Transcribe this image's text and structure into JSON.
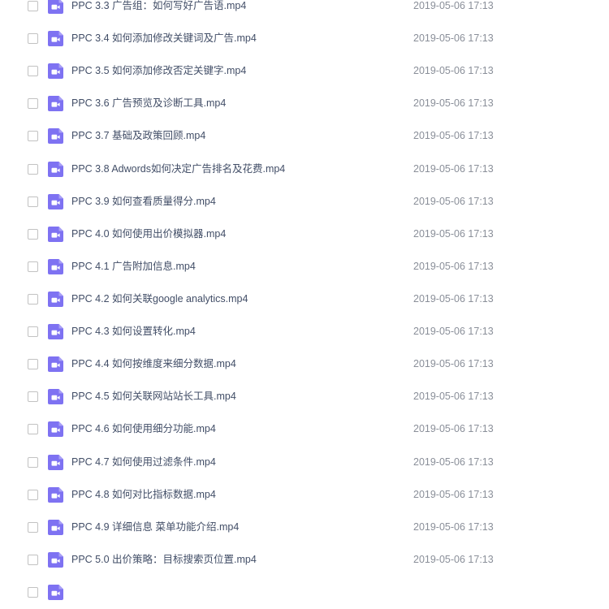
{
  "file_list": {
    "items": [
      {
        "name": "PPC 3.3 广告组：如何写好广告语.mp4",
        "date": "2019-05-06 17:13",
        "icon": "video-file-icon"
      },
      {
        "name": "PPC 3.4 如何添加修改关键词及广告.mp4",
        "date": "2019-05-06 17:13",
        "icon": "video-file-icon"
      },
      {
        "name": "PPC 3.5 如何添加修改否定关键字.mp4",
        "date": "2019-05-06 17:13",
        "icon": "video-file-icon"
      },
      {
        "name": "PPC 3.6 广告预览及诊断工具.mp4",
        "date": "2019-05-06 17:13",
        "icon": "video-file-icon"
      },
      {
        "name": "PPC 3.7 基础及政策回顾.mp4",
        "date": "2019-05-06 17:13",
        "icon": "video-file-icon"
      },
      {
        "name": "PPC 3.8 Adwords如何决定广告排名及花费.mp4",
        "date": "2019-05-06 17:13",
        "icon": "video-file-icon"
      },
      {
        "name": "PPC 3.9 如何查看质量得分.mp4",
        "date": "2019-05-06 17:13",
        "icon": "video-file-icon"
      },
      {
        "name": "PPC 4.0 如何使用出价模拟器.mp4",
        "date": "2019-05-06 17:13",
        "icon": "video-file-icon"
      },
      {
        "name": "PPC 4.1 广告附加信息.mp4",
        "date": "2019-05-06 17:13",
        "icon": "video-file-icon"
      },
      {
        "name": "PPC 4.2 如何关联google analytics.mp4",
        "date": "2019-05-06 17:13",
        "icon": "video-file-icon"
      },
      {
        "name": "PPC 4.3 如何设置转化.mp4",
        "date": "2019-05-06 17:13",
        "icon": "video-file-icon"
      },
      {
        "name": "PPC 4.4 如何按维度来细分数据.mp4",
        "date": "2019-05-06 17:13",
        "icon": "video-file-icon"
      },
      {
        "name": "PPC 4.5 如何关联网站站长工具.mp4",
        "date": "2019-05-06 17:13",
        "icon": "video-file-icon"
      },
      {
        "name": "PPC 4.6 如何使用细分功能.mp4",
        "date": "2019-05-06 17:13",
        "icon": "video-file-icon"
      },
      {
        "name": "PPC 4.7 如何使用过滤条件.mp4",
        "date": "2019-05-06 17:13",
        "icon": "video-file-icon"
      },
      {
        "name": "PPC 4.8 如何对比指标数据.mp4",
        "date": "2019-05-06 17:13",
        "icon": "video-file-icon"
      },
      {
        "name": "PPC 4.9 详细信息 菜单功能介绍.mp4",
        "date": "2019-05-06 17:13",
        "icon": "video-file-icon"
      },
      {
        "name": "PPC 5.0 出价策略：目标搜索页位置.mp4",
        "date": "2019-05-06 17:13",
        "icon": "video-file-icon"
      },
      {
        "name": "",
        "date": "",
        "icon": "video-file-icon"
      }
    ]
  },
  "colors": {
    "icon_accent": "#7e72f2",
    "file_name_text": "#424e67",
    "date_text": "#8a8f99",
    "checkbox_border": "#c2c2c2"
  }
}
